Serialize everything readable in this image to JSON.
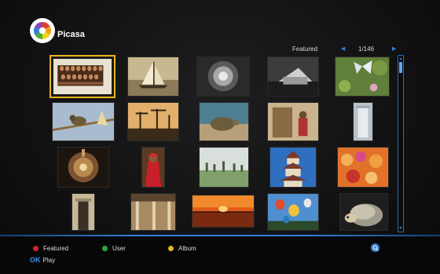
{
  "app": {
    "name": "Picasa"
  },
  "nav": {
    "category": "Featured",
    "page": "1/146"
  },
  "photos": [
    {
      "subject": "carved wooden panel",
      "selected": true
    },
    {
      "subject": "sailing boat"
    },
    {
      "subject": "flower close-up"
    },
    {
      "subject": "stone monument"
    },
    {
      "subject": "butterfly on flowers"
    },
    {
      "subject": "bird on branch"
    },
    {
      "subject": "harbor cranes at sunset"
    },
    {
      "subject": "sea turtle"
    },
    {
      "subject": "child in doorway"
    },
    {
      "subject": "white pillar"
    },
    {
      "subject": "temple dome"
    },
    {
      "subject": "woman in red sari"
    },
    {
      "subject": "trees on horizon"
    },
    {
      "subject": "pagoda tower"
    },
    {
      "subject": "festival crowd"
    },
    {
      "subject": "doorway"
    },
    {
      "subject": "building veranda"
    },
    {
      "subject": "sunset over water"
    },
    {
      "subject": "hot air balloons"
    },
    {
      "subject": "hedgehog"
    }
  ],
  "footer": {
    "featured_label": "Featured",
    "user_label": "User",
    "album_label": "Album",
    "ok_key": "OK",
    "ok_label": "Play",
    "colors": {
      "featured": "#d6222a",
      "user": "#2aa83a",
      "album": "#e4b41c",
      "accent": "#2f7ed0"
    }
  }
}
